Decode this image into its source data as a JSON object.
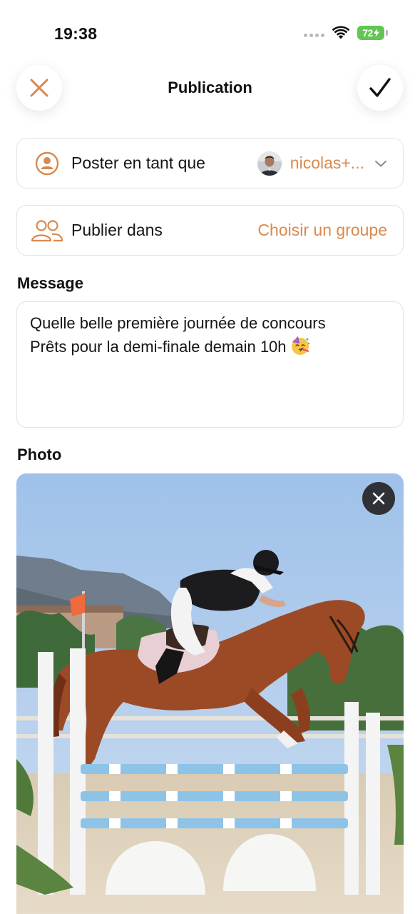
{
  "status_bar": {
    "time": "19:38",
    "battery": "72",
    "icons": [
      "signal-dots-icon",
      "wifi-icon",
      "battery-charging-icon"
    ]
  },
  "header": {
    "title": "Publication",
    "close_icon": "close-icon",
    "confirm_icon": "checkmark-icon"
  },
  "poster": {
    "label": "Poster en tant que",
    "value": "nicolas+...",
    "icon": "user-circle-icon"
  },
  "publish_in": {
    "label": "Publier dans",
    "value": "Choisir un groupe",
    "icon": "group-icon"
  },
  "message": {
    "label": "Message",
    "text": "Quelle belle première journée de concours\nPrêts pour la demi-finale demain 10h"
  },
  "photo": {
    "label": "Photo",
    "remove_icon": "close-icon"
  },
  "colors": {
    "accent": "#d9894e",
    "border": "#e3e3e3",
    "battery": "#62c554"
  }
}
